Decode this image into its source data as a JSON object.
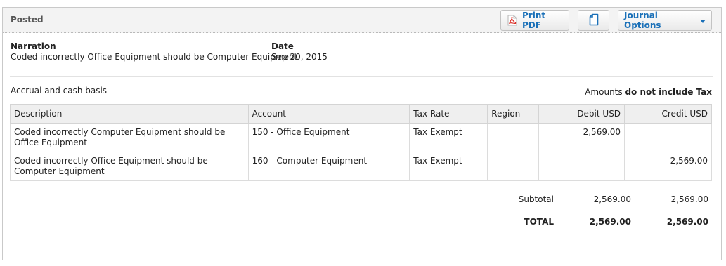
{
  "status": "Posted",
  "toolbar": {
    "print_pdf_label": "Print PDF",
    "journal_options_label": "Journal Options",
    "accent_color": "#1a70b8"
  },
  "details": {
    "narration_label": "Narration",
    "narration_value": "Coded incorrectly Office Equipment should be Computer Equipment",
    "date_label": "Date",
    "date_value": "Sep 20, 2015"
  },
  "basis": "Accrual and cash basis",
  "tax_note": {
    "prefix": "Amounts",
    "emphasis": "do not include Tax"
  },
  "table": {
    "headers": [
      "Description",
      "Account",
      "Tax Rate",
      "Region",
      "Debit USD",
      "Credit USD"
    ],
    "rows": [
      [
        "Coded incorrectly Computer Equipment should be Office Equipment",
        "150 - Office Equipment",
        "Tax Exempt",
        "",
        "2,569.00",
        ""
      ],
      [
        "Coded incorrectly Office Equipment should be Computer Equipment",
        "160 - Computer Equipment",
        "Tax Exempt",
        "",
        "",
        "2,569.00"
      ]
    ]
  },
  "totals": {
    "subtotal_label": "Subtotal",
    "subtotal_debit": "2,569.00",
    "subtotal_credit": "2,569.00",
    "total_label": "TOTAL",
    "total_debit": "2,569.00",
    "total_credit": "2,569.00"
  },
  "icons": {
    "print": "pdf-icon",
    "copy": "copy-icon",
    "dropdown": "caret-down-icon"
  }
}
